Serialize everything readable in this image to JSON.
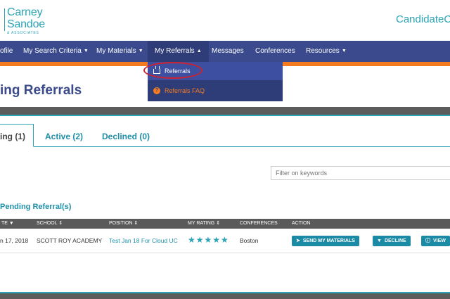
{
  "header": {
    "logo_line1": "Carney",
    "logo_line2": "Sandoe",
    "logo_line3": "& ASSOCIATES",
    "brand_right": "CandidateC"
  },
  "nav": {
    "items": [
      {
        "label": "ofile"
      },
      {
        "label": "My Search Criteria"
      },
      {
        "label": "My Materials"
      },
      {
        "label": "My Referrals"
      },
      {
        "label": "Messages"
      },
      {
        "label": "Conferences"
      },
      {
        "label": "Resources"
      }
    ],
    "dropdown": [
      {
        "label": "Referrals",
        "icon": "inbox-icon"
      },
      {
        "label": "Referrals FAQ",
        "icon": "question-icon"
      }
    ]
  },
  "page": {
    "title": "ing Referrals"
  },
  "tabs": [
    {
      "label": "ing (1)"
    },
    {
      "label": "Active (2)"
    },
    {
      "label": "Declined (0)"
    }
  ],
  "filter": {
    "placeholder": "Filter on keywords"
  },
  "section": {
    "title": "Pending Referral(s)"
  },
  "table": {
    "headers": [
      "TE",
      "SCHOOL",
      "POSITION",
      "MY RATING",
      "CONFERENCES",
      "ACTION"
    ],
    "row": {
      "date": "n 17, 2018",
      "school": "SCOTT ROY ACADEMY",
      "position": "Test Jan 18 For Cloud UC",
      "rating_stars": "★★★★★",
      "conference": "Boston",
      "actions": [
        "SEND MY MATERIALS",
        "DECLINE",
        "VIEW"
      ]
    }
  },
  "colors": {
    "nav": "#3a4a8c",
    "accent": "#2aa3b5",
    "orange": "#f47b20",
    "button": "#1a8aa5"
  }
}
